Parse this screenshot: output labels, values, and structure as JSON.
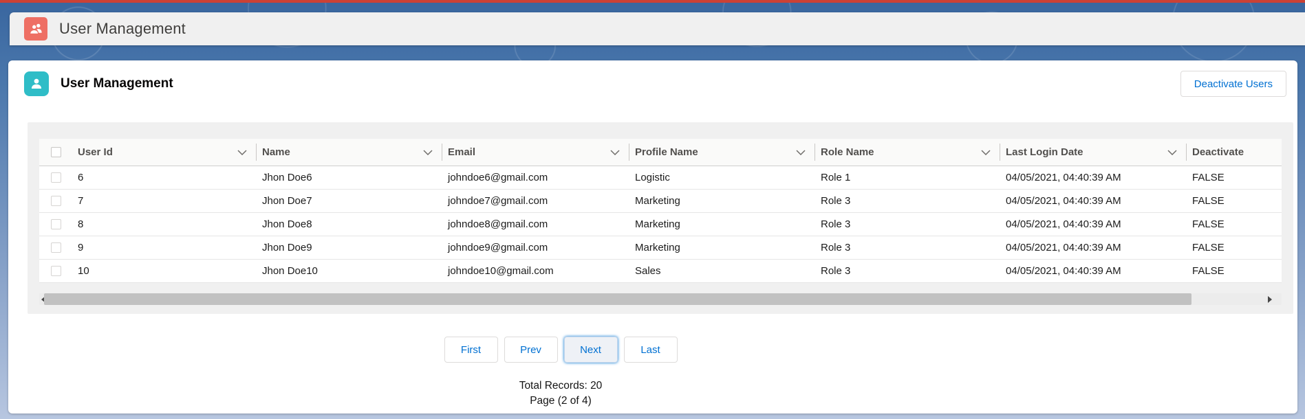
{
  "header": {
    "title": "User Management"
  },
  "card": {
    "title": "User Management",
    "deactivate_button_label": "Deactivate Users"
  },
  "table": {
    "select_all_checked": false,
    "columns": [
      {
        "label": "User Id",
        "field": "user_id",
        "sortable": true
      },
      {
        "label": "Name",
        "field": "name",
        "sortable": true
      },
      {
        "label": "Email",
        "field": "email",
        "sortable": true
      },
      {
        "label": "Profile Name",
        "field": "profile_name",
        "sortable": true
      },
      {
        "label": "Role Name",
        "field": "role_name",
        "sortable": true
      },
      {
        "label": "Last Login Date",
        "field": "last_login_date",
        "sortable": true
      },
      {
        "label": "Deactivate",
        "field": "deactivate",
        "sortable": false
      }
    ],
    "rows": [
      {
        "selected": false,
        "user_id": "6",
        "name": "Jhon Doe6",
        "email": "johndoe6@gmail.com",
        "profile_name": "Logistic",
        "role_name": "Role 1",
        "last_login_date": "04/05/2021, 04:40:39 AM",
        "deactivate": "FALSE"
      },
      {
        "selected": false,
        "user_id": "7",
        "name": "Jhon Doe7",
        "email": "johndoe7@gmail.com",
        "profile_name": "Marketing",
        "role_name": "Role 3",
        "last_login_date": "04/05/2021, 04:40:39 AM",
        "deactivate": "FALSE"
      },
      {
        "selected": false,
        "user_id": "8",
        "name": "Jhon Doe8",
        "email": "johndoe8@gmail.com",
        "profile_name": "Marketing",
        "role_name": "Role 3",
        "last_login_date": "04/05/2021, 04:40:39 AM",
        "deactivate": "FALSE"
      },
      {
        "selected": false,
        "user_id": "9",
        "name": "Jhon Doe9",
        "email": "johndoe9@gmail.com",
        "profile_name": "Marketing",
        "role_name": "Role 3",
        "last_login_date": "04/05/2021, 04:40:39 AM",
        "deactivate": "FALSE"
      },
      {
        "selected": false,
        "user_id": "10",
        "name": "Jhon Doe10",
        "email": "johndoe10@gmail.com",
        "profile_name": "Sales",
        "role_name": "Role 3",
        "last_login_date": "04/05/2021, 04:40:39 AM",
        "deactivate": "FALSE"
      }
    ]
  },
  "pagination": {
    "first_label": "First",
    "prev_label": "Prev",
    "next_label": "Next",
    "last_label": "Last",
    "focused": "Next"
  },
  "footer": {
    "total_records": "Total Records: 20",
    "page_info": "Page (2 of 4)"
  },
  "icons": {
    "app_icon": "users-icon",
    "card_icon": "user-icon",
    "column_sort": "chevron-down-icon",
    "scroll_left": "left-arrow-icon",
    "scroll_right": "right-arrow-icon"
  },
  "colors": {
    "top_accent": "#cb4136",
    "app_icon_bg": "#ee6f64",
    "card_icon_bg": "#2fbdc7",
    "action_blue": "#0070d2",
    "page_bg_top": "#39669f",
    "page_bg_bottom": "#b7c6e0"
  }
}
